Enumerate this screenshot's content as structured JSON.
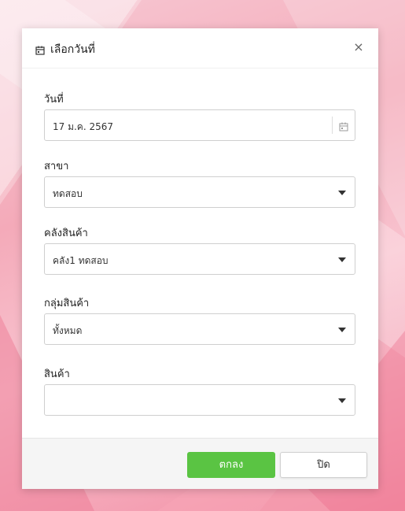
{
  "dialog": {
    "title": "เลือกวันที่",
    "close_label": "×"
  },
  "fields": {
    "date": {
      "label": "วันที่",
      "value": "17 ม.ค. 2567"
    },
    "branch": {
      "label": "สาขา",
      "value": "ทดสอบ"
    },
    "warehouse": {
      "label": "คลังสินค้า",
      "value": "คลัง1 ทดสอบ"
    },
    "product_group": {
      "label": "กลุ่มสินค้า",
      "value": "ทั้งหมด"
    },
    "product": {
      "label": "สินค้า",
      "value": ""
    }
  },
  "footer": {
    "ok_label": "ตกลง",
    "close_label": "ปิด"
  },
  "colors": {
    "ok_button": "#5ac443",
    "background": "#f4aab9"
  },
  "icons": [
    "calendar-icon",
    "close-icon",
    "chevron-down-icon"
  ]
}
